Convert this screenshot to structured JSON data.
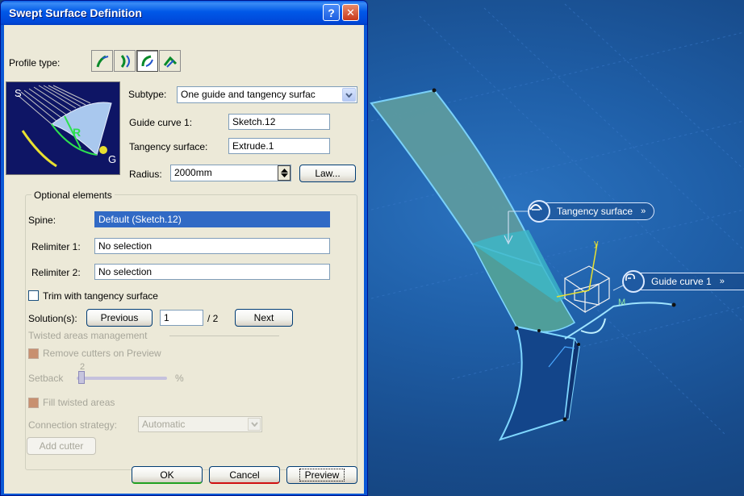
{
  "window": {
    "title": "Swept Surface Definition",
    "help_glyph": "?",
    "close_glyph": "✕"
  },
  "profile": {
    "label": "Profile type:",
    "types": [
      {
        "name": "line-profile-icon",
        "selected": false
      },
      {
        "name": "circle-profile-icon",
        "selected": false
      },
      {
        "name": "conic-profile-icon",
        "selected": true
      },
      {
        "name": "explicit-profile-icon",
        "selected": false
      }
    ]
  },
  "preview_image": {
    "labels": {
      "s": "S",
      "r": "R",
      "g": "G"
    }
  },
  "subtype": {
    "label": "Subtype:",
    "value": "One guide and tangency surfac"
  },
  "guide_curve": {
    "label": "Guide curve 1:",
    "value": "Sketch.12"
  },
  "tangency_surface": {
    "label": "Tangency surface:",
    "value": "Extrude.1"
  },
  "radius": {
    "label": "Radius:",
    "value": "2000mm",
    "law_label": "Law..."
  },
  "optional": {
    "title": "Optional elements",
    "spine_label": "Spine:",
    "spine_value": "Default (Sketch.12)",
    "relimiter1_label": "Relimiter 1:",
    "relimiter1_value": "No selection",
    "relimiter2_label": "Relimiter 2:",
    "relimiter2_value": "No selection"
  },
  "trim": {
    "label": "Trim with tangency surface",
    "checked": false
  },
  "solutions": {
    "label": "Solution(s):",
    "previous": "Previous",
    "current": "1",
    "total": "/ 2",
    "next": "Next"
  },
  "twisted": {
    "title": "Twisted areas management",
    "remove_cutters": "Remove cutters on Preview",
    "setback_label": "Setback",
    "setback_value": "2",
    "setback_unit": "%",
    "fill_twisted": "Fill twisted areas",
    "connection_label": "Connection strategy:",
    "connection_value": "Automatic",
    "add_cutter": "Add cutter"
  },
  "footer": {
    "ok": "OK",
    "cancel": "Cancel",
    "preview": "Preview"
  },
  "viewport": {
    "tangency_tag": "Tangency surface",
    "guide_tag": "Guide curve 1",
    "tag_chevron": "»",
    "axis_y": "y",
    "axis_m": "M"
  },
  "colors": {
    "xp_title": "#0058e8",
    "face": "#ece9d8",
    "selection": "#316ac5",
    "viewport_bg": "#1f5fa8"
  }
}
